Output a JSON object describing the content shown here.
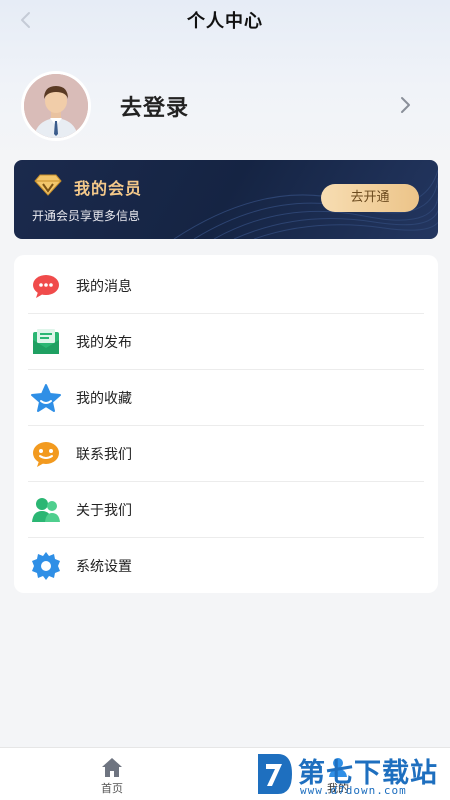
{
  "header": {
    "title": "个人中心",
    "back_icon": "chevron-left-icon"
  },
  "profile": {
    "login_label": "去登录",
    "avatar_icon": "user-avatar",
    "chevron_icon": "chevron-right-icon"
  },
  "vip": {
    "title": "我的会员",
    "description": "开通会员享更多信息",
    "button_label": "去开通",
    "gem_icon": "vip-diamond-icon",
    "colors": {
      "card_bg": "#1b2a4d",
      "title": "#f4c98a",
      "button_bg": "#ecc489"
    }
  },
  "menu": {
    "items": [
      {
        "label": "我的消息",
        "icon": "message-bubble-icon",
        "color": "#f04b4b"
      },
      {
        "label": "我的发布",
        "icon": "publish-envelope-icon",
        "color": "#2bb673"
      },
      {
        "label": "我的收藏",
        "icon": "star-icon",
        "color": "#2f8fe6"
      },
      {
        "label": "联系我们",
        "icon": "chat-face-icon",
        "color": "#f29a1f"
      },
      {
        "label": "关于我们",
        "icon": "users-icon",
        "color": "#2bb673"
      },
      {
        "label": "系统设置",
        "icon": "gear-icon",
        "color": "#2f8fe6"
      }
    ]
  },
  "tabbar": {
    "tabs": [
      {
        "label": "首页",
        "icon": "home-icon"
      },
      {
        "label": "我的",
        "icon": "user-icon"
      }
    ]
  },
  "watermark": {
    "name": "第七下载站",
    "url": "www.d7down.com"
  }
}
